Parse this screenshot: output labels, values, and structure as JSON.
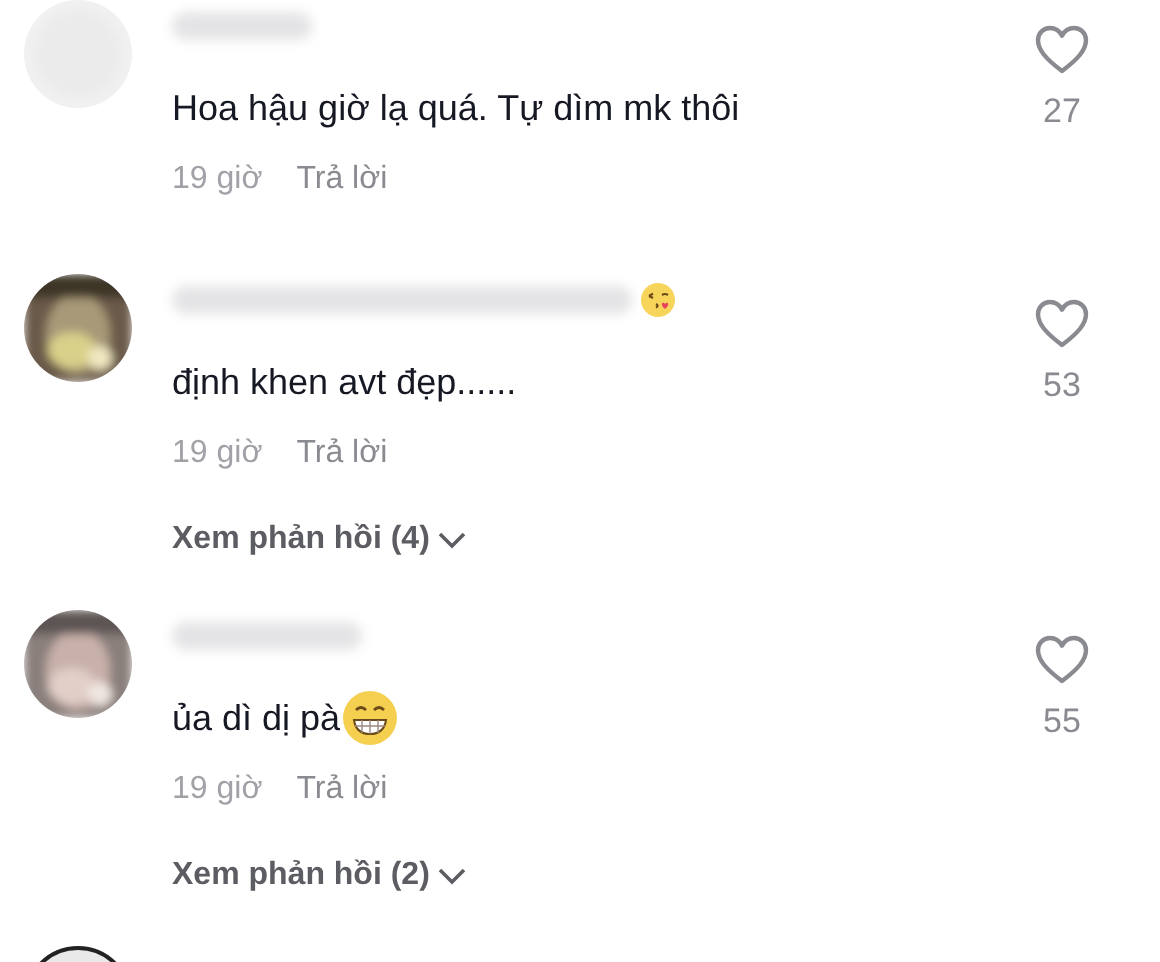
{
  "comments": [
    {
      "text": "Hoa hậu giờ lạ quá. Tự dìm mk thôi",
      "time": "19 giờ",
      "reply": "Trả lời",
      "likes": "27",
      "liked": false
    },
    {
      "name_emoji": true,
      "text": "định khen avt đẹp......",
      "time": "19 giờ",
      "reply": "Trả lời",
      "likes": "53",
      "liked": false,
      "view_replies": "Xem phản hồi (4)"
    },
    {
      "text": "ủa dì dị pà",
      "text_emoji": true,
      "time": "19 giờ",
      "reply": "Trả lời",
      "likes": "55",
      "liked": false,
      "view_replies": "Xem phản hồi (2)"
    }
  ]
}
